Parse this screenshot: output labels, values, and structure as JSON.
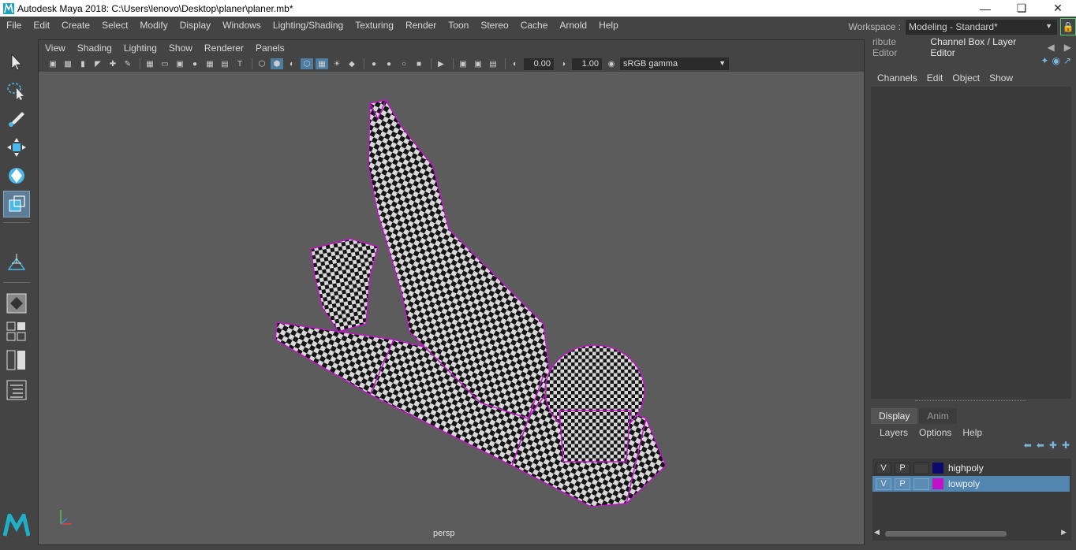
{
  "window": {
    "title": "Autodesk Maya 2018: C:\\Users\\lenovo\\Desktop\\planer\\planer.mb*",
    "minimize_icon": "minimize-icon",
    "restore_icon": "restore-icon",
    "close_icon": "close-icon"
  },
  "menubar": {
    "items": [
      "File",
      "Edit",
      "Create",
      "Select",
      "Modify",
      "Display",
      "Windows",
      "Lighting/Shading",
      "Texturing",
      "Render",
      "Toon",
      "Stereo",
      "Cache",
      "Arnold",
      "Help"
    ]
  },
  "workspace": {
    "label": "Workspace :",
    "value": "Modeling - Standard*"
  },
  "toolbox": {
    "tools": [
      "select-tool-icon",
      "lasso-tool-icon",
      "paint-select-icon",
      "move-tool-icon",
      "rotate-tool-icon",
      "scale-tool-icon",
      "soft-mod-icon",
      "single-layout-icon",
      "four-layout-icon",
      "two-layout-icon",
      "outliner-icon"
    ],
    "active": "scale-tool-icon"
  },
  "viewport": {
    "menu": [
      "View",
      "Shading",
      "Lighting",
      "Show",
      "Renderer",
      "Panels"
    ],
    "exposure": "0.00",
    "gamma": "1.00",
    "color_space": "sRGB gamma",
    "camera": "persp",
    "colors": {
      "background": "#5c5c5c",
      "wireframe": "#c014c8"
    }
  },
  "right_panel": {
    "tabs": [
      "ribute Editor",
      "Channel Box / Layer Editor"
    ],
    "active_tab": "Channel Box / Layer Editor",
    "channel_menu": [
      "Channels",
      "Edit",
      "Object",
      "Show"
    ],
    "layer_tabs": [
      "Display",
      "Anim"
    ],
    "active_layer_tab": "Display",
    "layer_menu": [
      "Layers",
      "Options",
      "Help"
    ],
    "layers": [
      {
        "v": "V",
        "p": "P",
        "name": "highpoly",
        "color": "#0b0b6e",
        "selected": false
      },
      {
        "v": "V",
        "p": "P",
        "name": "lowpoly",
        "color": "#c013c8",
        "selected": true
      }
    ]
  }
}
